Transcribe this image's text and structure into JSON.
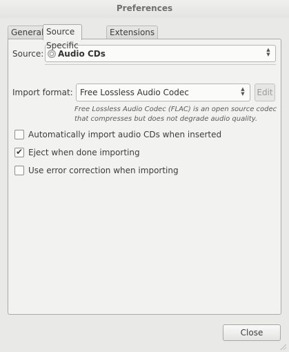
{
  "window": {
    "title": "Preferences"
  },
  "tabs": [
    {
      "label": "General",
      "active": false
    },
    {
      "label": "Source Specific",
      "active": true
    },
    {
      "label": "Extensions",
      "active": false
    }
  ],
  "source": {
    "label": "Source:",
    "value": "Audio CDs",
    "icon": "cd-icon"
  },
  "import_format": {
    "label": "Import format:",
    "value": "Free Lossless Audio Codec",
    "edit_label": "Edit",
    "description": "Free Lossless Audio Codec (FLAC) is an open source codec that compresses but does not degrade audio quality."
  },
  "options": [
    {
      "label": "Automatically import audio CDs when inserted",
      "checked": false
    },
    {
      "label": "Eject when done importing",
      "checked": true
    },
    {
      "label": "Use error correction when importing",
      "checked": false
    }
  ],
  "footer": {
    "close_label": "Close"
  },
  "colors": {
    "window_bg": "#e9e9e7",
    "panel_bg": "#f2f2f1",
    "border": "#a9a9a7"
  }
}
